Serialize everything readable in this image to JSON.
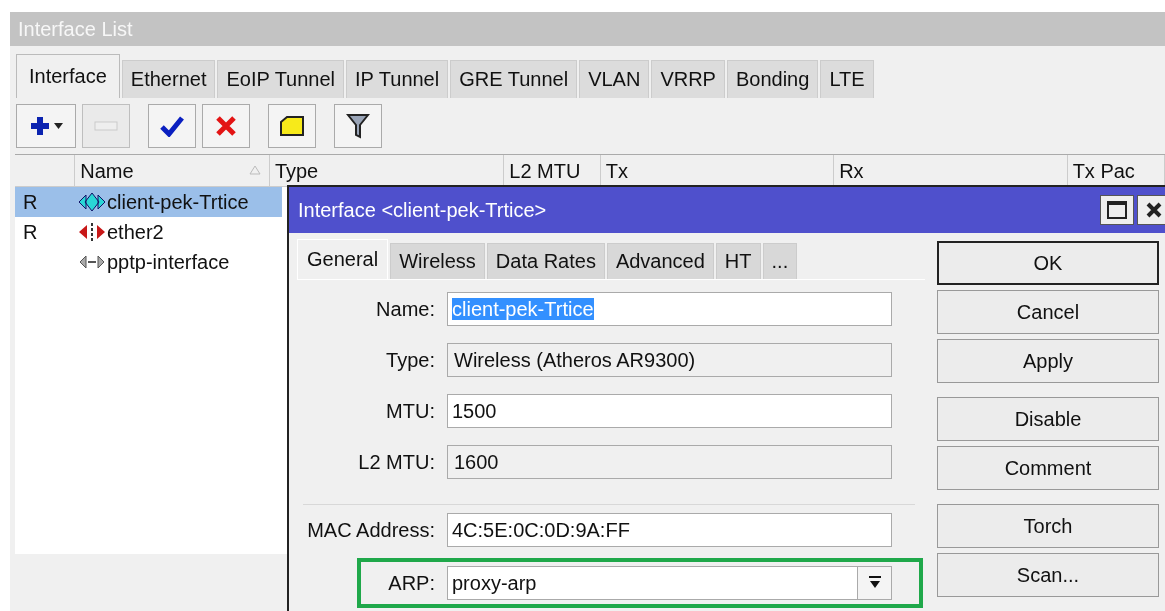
{
  "window": {
    "title": "Interface List"
  },
  "tabs": [
    {
      "label": "Interface",
      "selected": true
    },
    {
      "label": "Ethernet",
      "selected": false
    },
    {
      "label": "EoIP Tunnel",
      "selected": false
    },
    {
      "label": "IP Tunnel",
      "selected": false
    },
    {
      "label": "GRE Tunnel",
      "selected": false
    },
    {
      "label": "VLAN",
      "selected": false
    },
    {
      "label": "VRRP",
      "selected": false
    },
    {
      "label": "Bonding",
      "selected": false
    },
    {
      "label": "LTE",
      "selected": false
    }
  ],
  "toolbar": [
    {
      "kind": "add",
      "disabled": false
    },
    {
      "kind": "remove",
      "disabled": true
    },
    {
      "kind": "enable",
      "disabled": false
    },
    {
      "kind": "disable",
      "disabled": false
    },
    {
      "kind": "comment",
      "disabled": false
    },
    {
      "kind": "filter",
      "disabled": false
    }
  ],
  "table": {
    "columns": [
      "Name",
      "Type",
      "L2 MTU",
      "Tx",
      "Rx",
      "Tx Pac"
    ],
    "rows": [
      {
        "flag": "R",
        "name": "client-pek-Trtice",
        "kind": "wireless",
        "selected": true
      },
      {
        "flag": "R",
        "name": "ether2",
        "kind": "ethernet",
        "selected": false
      },
      {
        "name": "pptp-interface",
        "kind": "pptp",
        "selected": false
      }
    ]
  },
  "dialog": {
    "title": "Interface <client-pek-Trtice>",
    "tabs": [
      {
        "label": "General",
        "selected": true
      },
      {
        "label": "Wireless",
        "selected": false
      },
      {
        "label": "Data Rates",
        "selected": false
      },
      {
        "label": "Advanced",
        "selected": false
      },
      {
        "label": "HT",
        "selected": false
      },
      {
        "label": "...",
        "selected": false
      }
    ],
    "fields": [
      {
        "label": "Name:",
        "value": "client-pek-Trtice",
        "kind": "text",
        "text_selected": true
      },
      {
        "label": "Type:",
        "value": "Wireless (Atheros AR9300)",
        "kind": "readonly"
      },
      {
        "label": "MTU:",
        "value": "1500",
        "kind": "text"
      },
      {
        "label": "L2 MTU:",
        "value": "1600",
        "kind": "readonly"
      },
      {
        "label": "MAC Address:",
        "value": "4C:5E:0C:0D:9A:FF",
        "kind": "text",
        "separator_before": true
      },
      {
        "label": "ARP:",
        "value": "proxy-arp",
        "kind": "dropdown",
        "highlighted": true
      }
    ],
    "buttons": [
      {
        "label": "OK",
        "default": true
      },
      {
        "label": "Cancel"
      },
      {
        "label": "Apply"
      },
      {
        "label": "Disable",
        "gap_before": true
      },
      {
        "label": "Comment"
      },
      {
        "label": "Torch",
        "gap_before": true
      },
      {
        "label": "Scan..."
      }
    ]
  }
}
